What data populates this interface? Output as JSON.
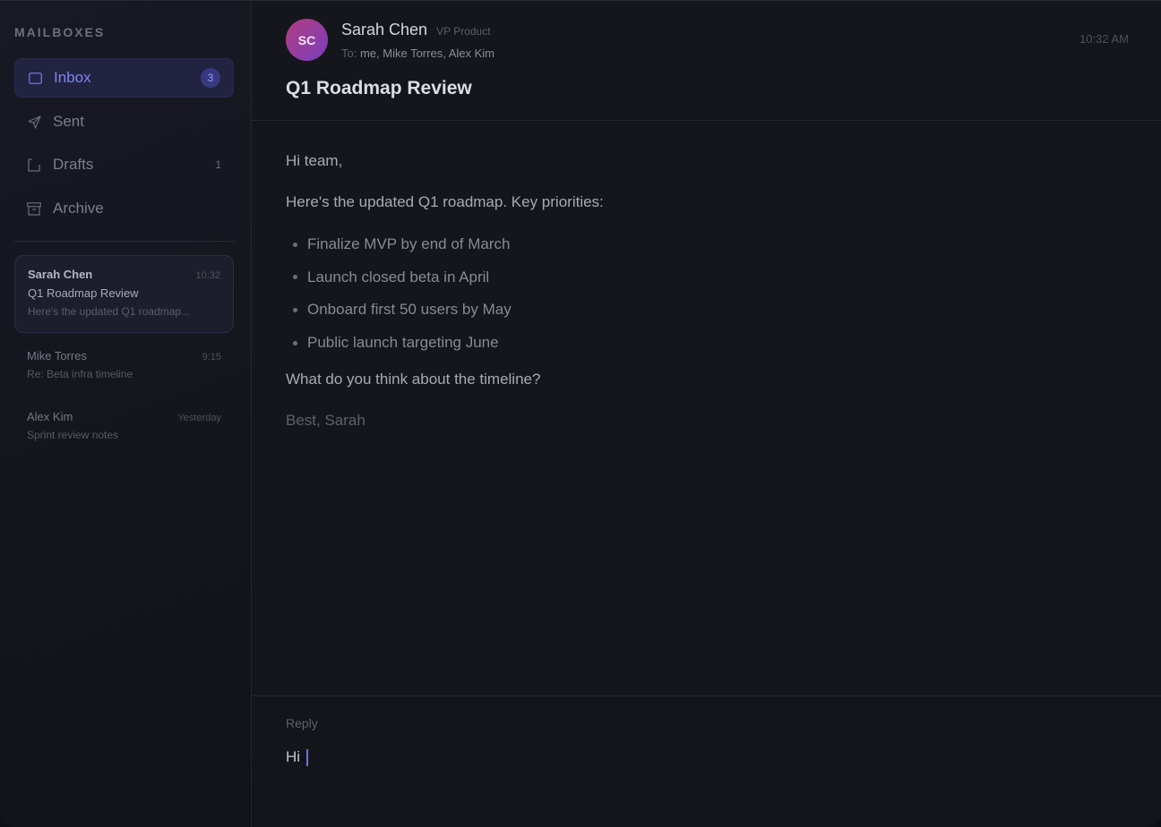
{
  "sidebar": {
    "heading": "MAILBOXES",
    "mailboxes": [
      {
        "label": "Inbox",
        "icon": "inbox-icon",
        "count": "3",
        "active": true
      },
      {
        "label": "Sent",
        "icon": "send-icon",
        "count": ""
      },
      {
        "label": "Drafts",
        "icon": "drafts-icon",
        "count": "1"
      },
      {
        "label": "Archive",
        "icon": "archive-icon",
        "count": ""
      }
    ],
    "messages": [
      {
        "sender": "Sarah Chen",
        "time": "10:32",
        "subject": "Q1 Roadmap Review",
        "preview": "Here's the updated Q1 roadmap..."
      },
      {
        "sender": "Mike Torres",
        "time": "9:15",
        "subject": "Re: Beta infra timeline"
      },
      {
        "sender": "Alex Kim",
        "time": "Yesterday",
        "subject": "Sprint review notes"
      }
    ]
  },
  "email": {
    "avatar_initials": "SC",
    "sender_name": "Sarah Chen",
    "sender_role": "VP Product",
    "to_label": "To:",
    "to_recipients": "me, Mike Torres, Alex Kim",
    "time": "10:32 AM",
    "subject": "Q1 Roadmap Review",
    "body": {
      "greeting": "Hi team,",
      "intro": "Here's the updated Q1 roadmap. Key priorities:",
      "bullets": [
        "Finalize MVP by end of March",
        "Launch closed beta in April",
        "Onboard first 50 users by May",
        "Public launch targeting June"
      ],
      "question": "What do you think about the timeline?",
      "signoff": "Best, Sarah"
    }
  },
  "reply": {
    "label": "Reply",
    "value": "Hi"
  },
  "colors": {
    "accent": "#6f72e8",
    "background": "#15161c",
    "avatar_gradient_start": "#b23c7e",
    "avatar_gradient_end": "#7a3fc0"
  }
}
